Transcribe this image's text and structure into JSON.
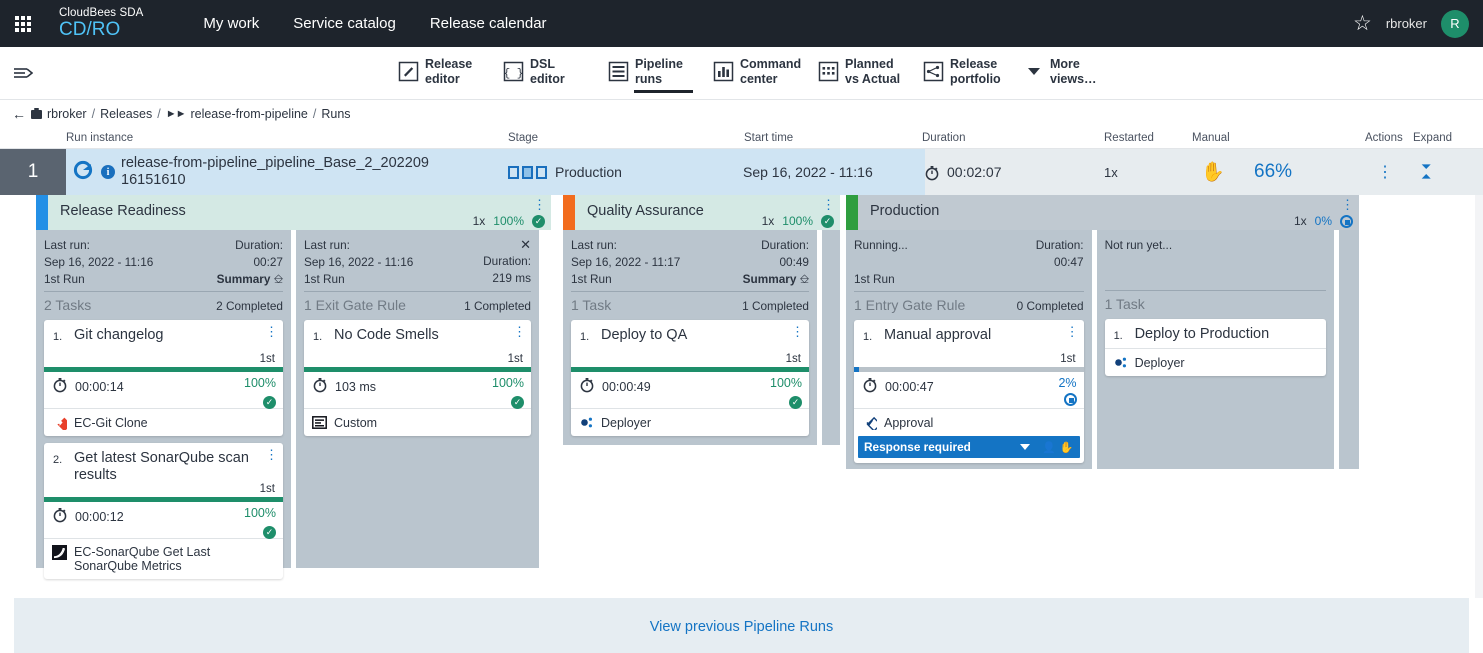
{
  "topbar": {
    "apps_icon": "grid-apps-icon",
    "brand_line1": "CloudBees SDA",
    "brand_line2": "CD/RO",
    "nav": [
      "My work",
      "Service catalog",
      "Release calendar"
    ],
    "star_icon": "star-outline-icon",
    "username": "rbroker",
    "avatar_initial": "R"
  },
  "subbar": {
    "collapse_icon": "collapse-sidebar-icon",
    "views": [
      {
        "label_l1": "Release",
        "label_l2": "editor",
        "icon": "pencil-box-icon",
        "active": false
      },
      {
        "label_l1": "DSL",
        "label_l2": "editor",
        "icon": "braces-box-icon",
        "active": false
      },
      {
        "label_l1": "Pipeline",
        "label_l2": "runs",
        "icon": "list-box-icon",
        "active": true
      },
      {
        "label_l1": "Command",
        "label_l2": "center",
        "icon": "bar-chart-box-icon",
        "active": false
      },
      {
        "label_l1": "Planned",
        "label_l2": "vs Actual",
        "icon": "calendar-box-icon",
        "active": false
      },
      {
        "label_l1": "Release",
        "label_l2": "portfolio",
        "icon": "network-box-icon",
        "active": false
      },
      {
        "label_l1": "More",
        "label_l2": "views…",
        "icon": "chevron-down-icon",
        "active": false
      }
    ]
  },
  "breadcrumb": {
    "back_icon": "arrow-left-icon",
    "project_icon": "briefcase-icon",
    "project": "rbroker",
    "section": "Releases",
    "pipeline_icon": "pipeline-icon",
    "pipeline": "release-from-pipeline",
    "current": "Runs",
    "sep": "/"
  },
  "table": {
    "headers": {
      "run_instance": "Run instance",
      "stage": "Stage",
      "start_time": "Start time",
      "duration": "Duration",
      "restarted": "Restarted",
      "manual": "Manual",
      "actions": "Actions",
      "expand": "Expand"
    },
    "row": {
      "number": "1",
      "refresh_icon": "refresh-circle-icon",
      "info_icon": "info-icon",
      "name_line1": "release-from-pipeline_pipeline_Base_2_202209",
      "name_line2": "16151610",
      "stage_icon": "stage-squares-icon",
      "stage": "Production",
      "start_time": "Sep 16, 2022 - 11:16",
      "duration_icon": "stopwatch-icon",
      "duration": "00:02:07",
      "restarted": "1x",
      "manual_icon": "hand-icon",
      "percent": "66%",
      "actions_icon": "kebab-menu-icon",
      "expand_icon": "chevrons-collapse-icon"
    }
  },
  "stages": [
    {
      "name": "Release Readiness",
      "accent_color": "#2490e6",
      "header_bg": "#d4e9e4",
      "restarted": "1x",
      "percent": "100%",
      "status": "done",
      "kebab_icon": "kebab-menu-icon",
      "lanes": [
        {
          "kind": "tasks",
          "last_run_label": "Last run:",
          "last_run_value": "Sep 16, 2022 - 11:16",
          "run_ordinal": "1st Run",
          "duration_label": "Duration:",
          "duration_value": "00:27",
          "summary_label": "Summary",
          "summary_icon": "open-panel-icon",
          "group_label": "2 Tasks",
          "group_count": "2 Completed",
          "cards": [
            {
              "num": "1.",
              "title": "Git changelog",
              "ordinal": "1st",
              "progress": 100,
              "bar_color": "green",
              "time_icon": "stopwatch-icon",
              "time": "00:00:14",
              "percent": "100%",
              "percent_color": "green",
              "status_icon": "check-circle-icon",
              "footer_icon": "ec-git-icon",
              "footer": "EC-Git Clone"
            },
            {
              "num": "2.",
              "title": "Get latest SonarQube scan results",
              "ordinal": "1st",
              "progress": 100,
              "bar_color": "green",
              "time_icon": "stopwatch-icon",
              "time": "00:00:12",
              "percent": "100%",
              "percent_color": "green",
              "status_icon": "check-circle-icon",
              "footer_icon": "sonarqube-icon",
              "footer": "EC-SonarQube Get Last SonarQube Metrics"
            }
          ]
        },
        {
          "kind": "gate",
          "close_icon": "close-icon",
          "last_run_label": "Last run:",
          "last_run_value": "Sep 16, 2022 - 11:16",
          "run_ordinal": "1st Run",
          "duration_label": "Duration:",
          "duration_value": "219 ms",
          "group_label": "1 Exit Gate Rule",
          "group_count": "1 Completed",
          "cards": [
            {
              "num": "1.",
              "title": "No Code Smells",
              "ordinal": "1st",
              "progress": 100,
              "bar_color": "green",
              "time_icon": "stopwatch-icon",
              "time": "103 ms",
              "percent": "100%",
              "percent_color": "green",
              "status_icon": "check-circle-icon",
              "footer_icon": "custom-rule-icon",
              "footer": "Custom"
            }
          ]
        }
      ]
    },
    {
      "name": "Quality Assurance",
      "accent_color": "#f26b1d",
      "header_bg": "#d4e9e4",
      "restarted": "1x",
      "percent": "100%",
      "status": "done",
      "kebab_icon": "kebab-menu-icon",
      "lanes": [
        {
          "kind": "tasks",
          "last_run_label": "Last run:",
          "last_run_value": "Sep 16, 2022 - 11:17",
          "run_ordinal": "1st Run",
          "duration_label": "Duration:",
          "duration_value": "00:49",
          "summary_label": "Summary",
          "summary_icon": "open-panel-icon",
          "group_label": "1 Task",
          "group_count": "1 Completed",
          "cards": [
            {
              "num": "1.",
              "title": "Deploy to QA",
              "ordinal": "1st",
              "progress": 100,
              "bar_color": "green",
              "time_icon": "stopwatch-icon",
              "time": "00:00:49",
              "percent": "100%",
              "percent_color": "green",
              "status_icon": "check-circle-icon",
              "footer_icon": "deployer-icon",
              "footer": "Deployer"
            }
          ]
        }
      ]
    },
    {
      "name": "Production",
      "accent_color": "#2f9e3f",
      "header_bg": "#c0c9d1",
      "restarted": "1x",
      "percent": "0%",
      "status": "running",
      "kebab_icon": "kebab-menu-icon",
      "lanes": [
        {
          "kind": "gate",
          "last_run_label": "Running...",
          "last_run_value": "",
          "run_ordinal": "1st Run",
          "duration_label": "Duration:",
          "duration_value": "00:47",
          "group_label": "1 Entry Gate Rule",
          "group_count": "0 Completed",
          "cards": [
            {
              "num": "1.",
              "title": "Manual approval",
              "ordinal": "1st",
              "progress": 2,
              "bar_color": "blue",
              "time_icon": "stopwatch-icon",
              "time": "00:00:47",
              "percent": "2%",
              "percent_color": "blue",
              "status_icon": "running-circle-icon",
              "footer_icon": "approval-icon",
              "footer": "Approval",
              "response": {
                "label": "Response required",
                "caret_icon": "chevron-down-icon",
                "person_icon": "person-icon",
                "hand_icon": "hand-icon"
              }
            }
          ]
        },
        {
          "kind": "tasks",
          "last_run_label": "Not run yet...",
          "last_run_value": "",
          "run_ordinal": "",
          "duration_label": "",
          "duration_value": "",
          "group_label": "1 Task",
          "group_count": "",
          "cards": [
            {
              "num": "1.",
              "title": "Deploy to Production",
              "ordinal": "",
              "progress": 0,
              "bar_color": "none",
              "time_icon": "",
              "time": "",
              "percent": "",
              "percent_color": "",
              "status_icon": "",
              "footer_icon": "deployer-icon",
              "footer": "Deployer"
            }
          ]
        }
      ]
    }
  ],
  "footer": {
    "link": "View previous Pipeline Runs"
  }
}
